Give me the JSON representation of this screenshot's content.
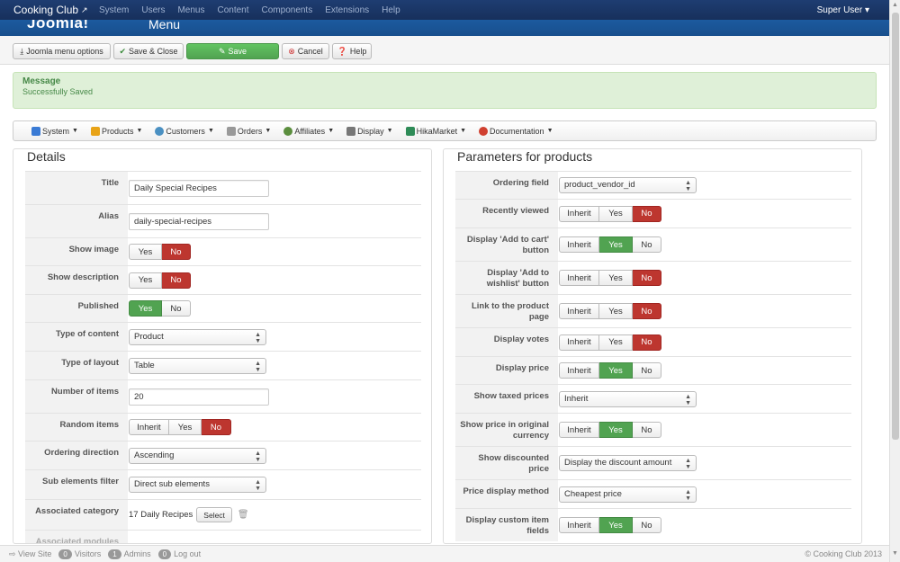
{
  "topnav": {
    "site_name": "Cooking Club",
    "menus": [
      "System",
      "Users",
      "Menus",
      "Content",
      "Components",
      "Extensions",
      "Help"
    ],
    "user": "Super User"
  },
  "header": {
    "logo": "Joomla!",
    "title": "Menu"
  },
  "toolbar": {
    "menu_options": "Joomla menu options",
    "save_close": "Save & Close",
    "save": "Save",
    "cancel": "Cancel",
    "help": "Help"
  },
  "message": {
    "heading": "Message",
    "body": "Successfully Saved"
  },
  "submenu": {
    "items": [
      {
        "label": "System",
        "color": "#3a7bd5"
      },
      {
        "label": "Products",
        "color": "#e8a317"
      },
      {
        "label": "Customers",
        "color": "#4a90c2"
      },
      {
        "label": "Orders",
        "color": "#999999"
      },
      {
        "label": "Affiliates",
        "color": "#5b8e3e"
      },
      {
        "label": "Display",
        "color": "#777777"
      },
      {
        "label": "HikaMarket",
        "color": "#2e8b57"
      },
      {
        "label": "Documentation",
        "color": "#d04030"
      }
    ]
  },
  "details": {
    "legend": "Details",
    "title_label": "Title",
    "title_value": "Daily Special Recipes",
    "alias_label": "Alias",
    "alias_value": "daily-special-recipes",
    "show_image_label": "Show image",
    "show_description_label": "Show description",
    "published_label": "Published",
    "type_content_label": "Type of content",
    "type_content_value": "Product",
    "type_layout_label": "Type of layout",
    "type_layout_value": "Table",
    "num_items_label": "Number of items",
    "num_items_value": "20",
    "random_items_label": "Random items",
    "ordering_dir_label": "Ordering direction",
    "ordering_dir_value": "Ascending",
    "sub_filter_label": "Sub elements filter",
    "sub_filter_value": "Direct sub elements",
    "assoc_cat_label": "Associated category",
    "assoc_cat_value": "17 Daily Recipes",
    "select_btn": "Select",
    "assoc_modules_label": "Associated modules"
  },
  "toggles": {
    "inherit": "Inherit",
    "yes": "Yes",
    "no": "No"
  },
  "params": {
    "legend": "Parameters for products",
    "ordering_field_label": "Ordering field",
    "ordering_field_value": "product_vendor_id",
    "recently_viewed_label": "Recently viewed",
    "add_to_cart_label": "Display 'Add to cart' button",
    "add_to_wishlist_label": "Display 'Add to wishlist' button",
    "link_product_label": "Link to the product page",
    "display_votes_label": "Display votes",
    "display_price_label": "Display price",
    "show_taxed_label": "Show taxed prices",
    "show_taxed_value": "Inherit",
    "price_original_label": "Show price in original currency",
    "show_discounted_label": "Show discounted price",
    "show_discounted_value": "Display the discount amount",
    "price_method_label": "Price display method",
    "price_method_value": "Cheapest price",
    "custom_fields_label": "Display custom item fields"
  },
  "statusbar": {
    "view_site": "View Site",
    "visitors_count": "0",
    "visitors": "Visitors",
    "admins_count": "1",
    "admins": "Admins",
    "logout_count": "0",
    "logout": "Log out",
    "copyright": "© Cooking Club 2013"
  }
}
